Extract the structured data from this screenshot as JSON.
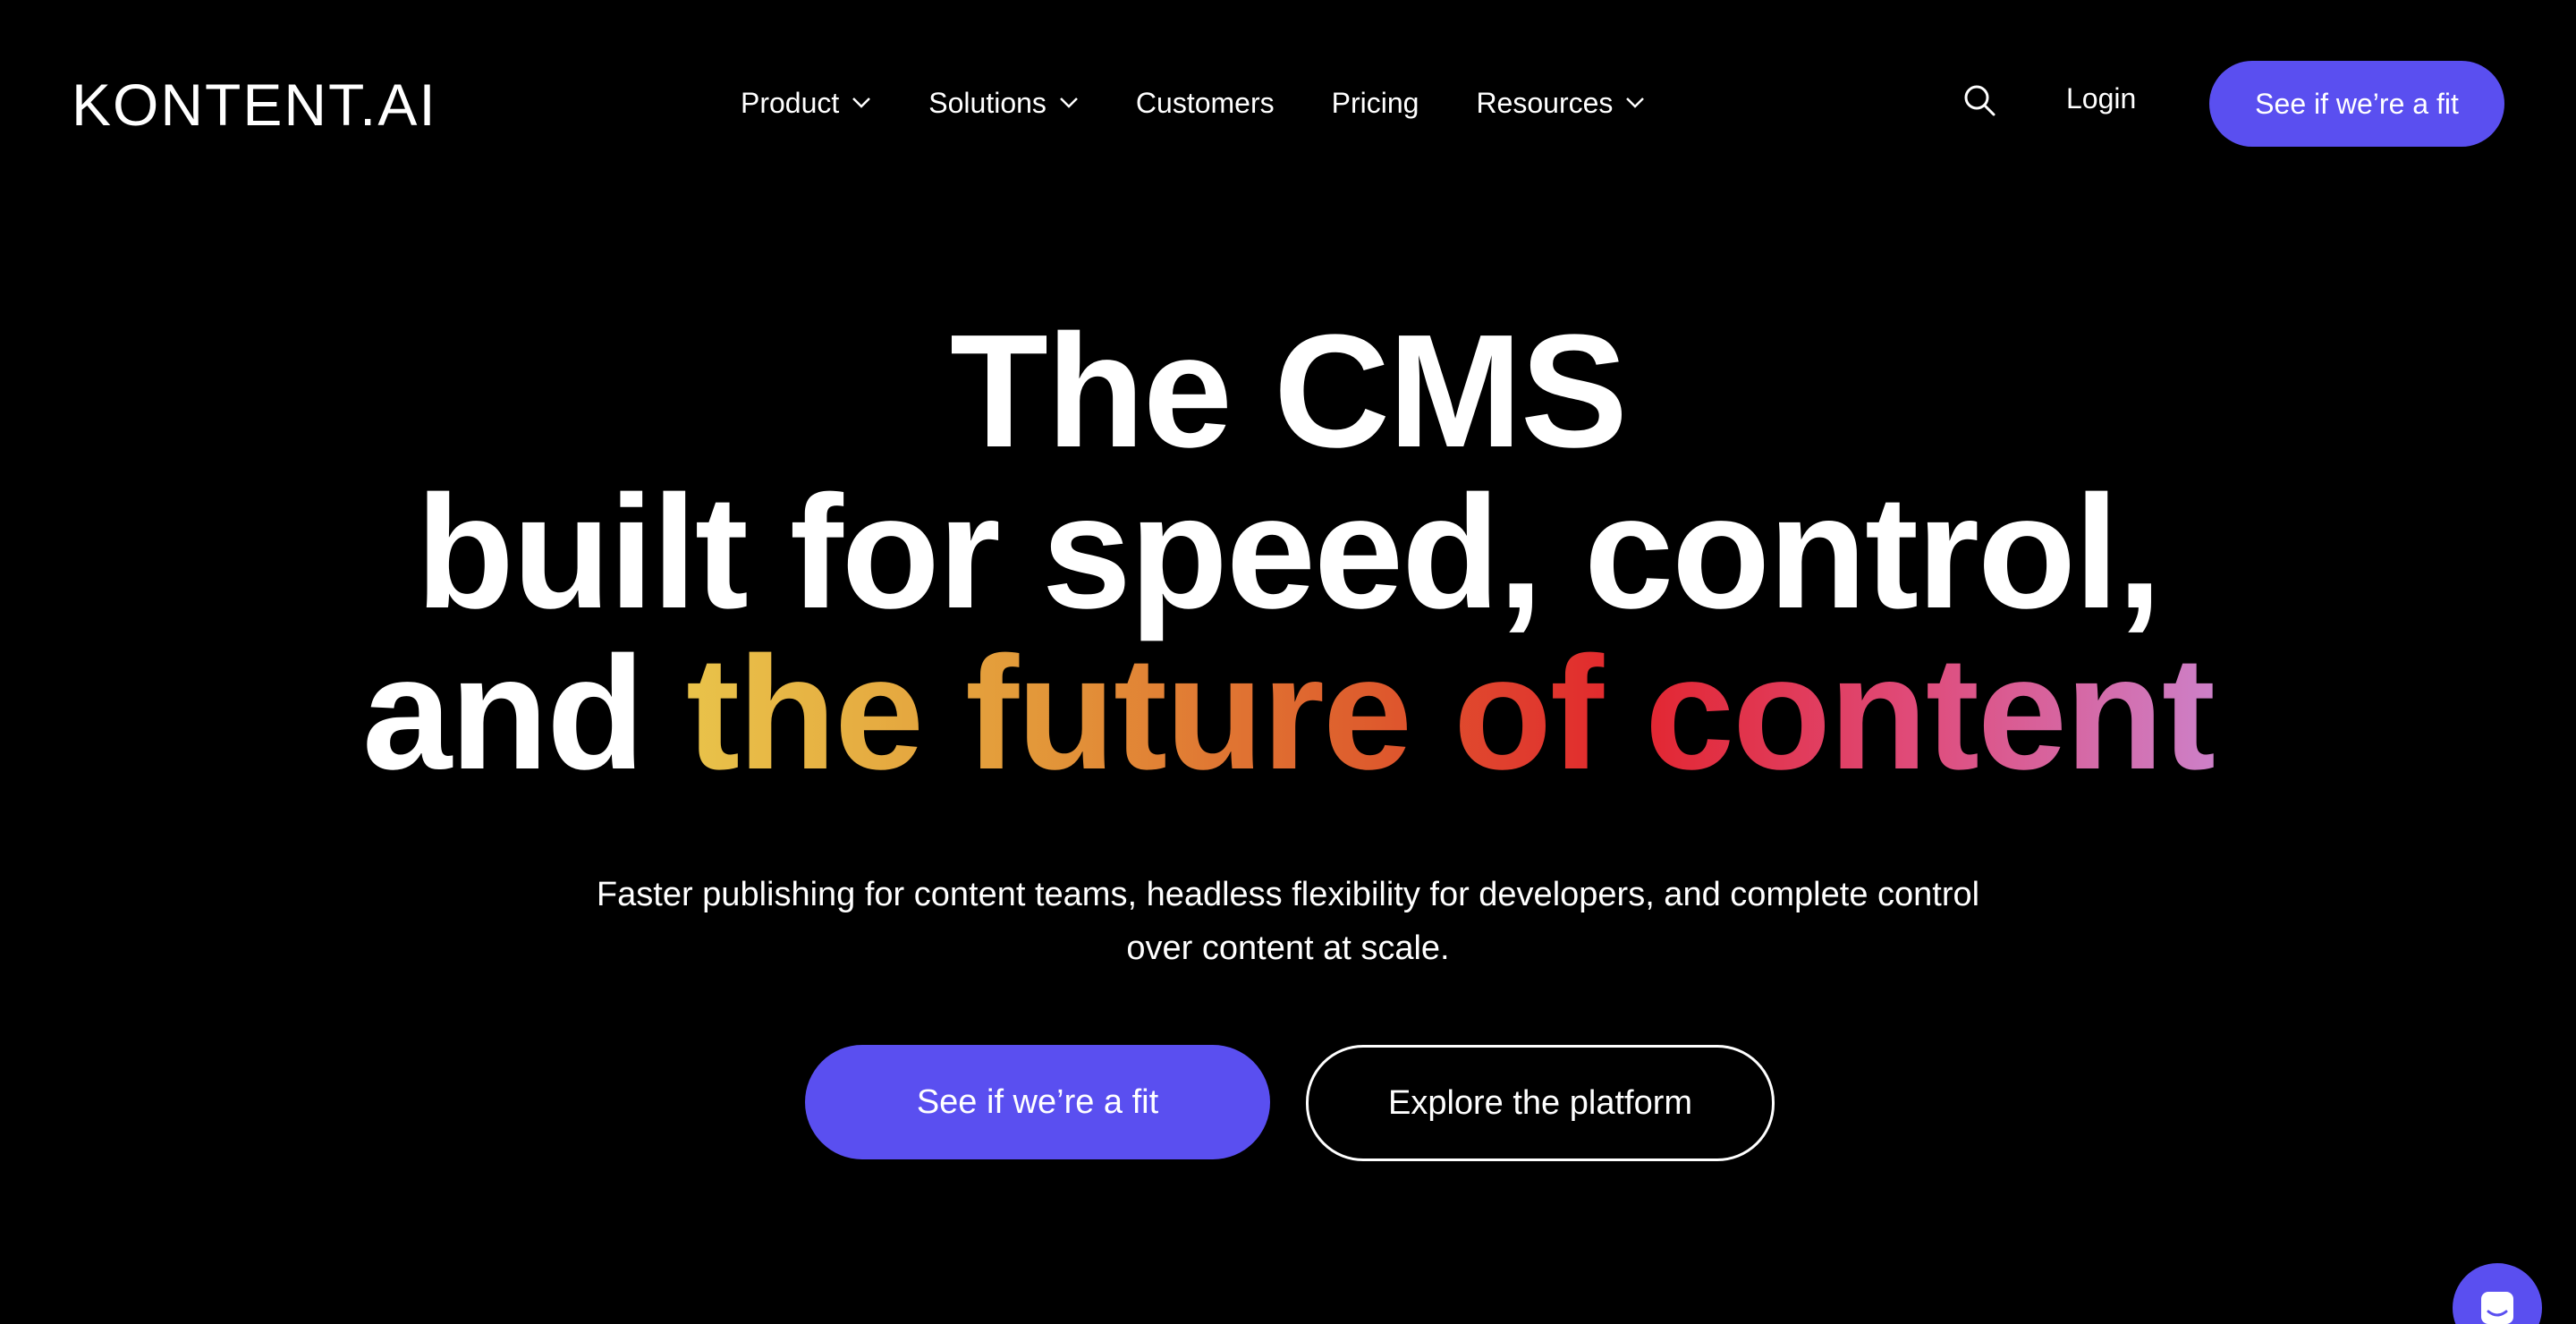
{
  "header": {
    "logo": "KONTENT.AI",
    "nav": [
      {
        "label": "Product",
        "has_dropdown": true
      },
      {
        "label": "Solutions",
        "has_dropdown": true
      },
      {
        "label": "Customers",
        "has_dropdown": false
      },
      {
        "label": "Pricing",
        "has_dropdown": false
      },
      {
        "label": "Resources",
        "has_dropdown": true
      }
    ],
    "search_icon": "search-icon",
    "login_label": "Login",
    "cta_label": "See if we’re a fit"
  },
  "hero": {
    "title_line1": "The CMS",
    "title_line2": "built for speed, control,",
    "title_line3_plain": "and ",
    "title_line3_gradient": "the future of content",
    "subtitle": "Faster publishing for content teams, headless flexibility for developers, and complete control over content at scale.",
    "primary_cta": "See if we’re a fit",
    "secondary_cta": "Explore the platform"
  },
  "colors": {
    "background": "#000000",
    "accent": "#5a4ff0",
    "text": "#ffffff",
    "gradient_stops": [
      "#e9c34a",
      "#e39a3a",
      "#de5b2d",
      "#e2252e",
      "#e04a78",
      "#cd80c8"
    ]
  },
  "chat_widget_icon": "chat-icon"
}
